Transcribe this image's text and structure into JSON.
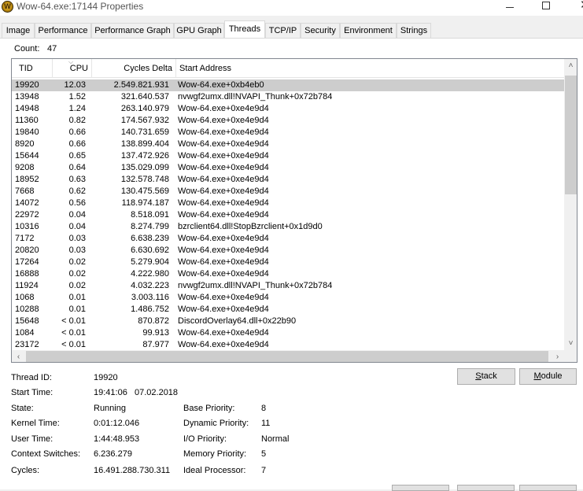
{
  "window": {
    "title": "Wow-64.exe:17144 Properties",
    "icon": "wow-logo-icon",
    "icon_letter": "W"
  },
  "tabs": [
    {
      "label": "Image"
    },
    {
      "label": "Performance"
    },
    {
      "label": "Performance Graph"
    },
    {
      "label": "GPU Graph"
    },
    {
      "label": "Threads",
      "active": true
    },
    {
      "label": "TCP/IP"
    },
    {
      "label": "Security"
    },
    {
      "label": "Environment"
    },
    {
      "label": "Strings"
    }
  ],
  "count": {
    "label": "Count:",
    "value": "47"
  },
  "threads": {
    "columns": [
      "TID",
      "CPU",
      "Cycles Delta",
      "Start Address"
    ],
    "rows": [
      {
        "tid": "19920",
        "cpu": "12.03",
        "cycles": "2.549.821.931",
        "address": "Wow-64.exe+0xb4eb0",
        "selected": true
      },
      {
        "tid": "13948",
        "cpu": "1.52",
        "cycles": "321.640.537",
        "address": "nvwgf2umx.dll!NVAPI_Thunk+0x72b784"
      },
      {
        "tid": "14948",
        "cpu": "1.24",
        "cycles": "263.140.979",
        "address": "Wow-64.exe+0xe4e9d4"
      },
      {
        "tid": "11360",
        "cpu": "0.82",
        "cycles": "174.567.932",
        "address": "Wow-64.exe+0xe4e9d4"
      },
      {
        "tid": "19840",
        "cpu": "0.66",
        "cycles": "140.731.659",
        "address": "Wow-64.exe+0xe4e9d4"
      },
      {
        "tid": "8920",
        "cpu": "0.66",
        "cycles": "138.899.404",
        "address": "Wow-64.exe+0xe4e9d4"
      },
      {
        "tid": "15644",
        "cpu": "0.65",
        "cycles": "137.472.926",
        "address": "Wow-64.exe+0xe4e9d4"
      },
      {
        "tid": "9208",
        "cpu": "0.64",
        "cycles": "135.029.099",
        "address": "Wow-64.exe+0xe4e9d4"
      },
      {
        "tid": "18952",
        "cpu": "0.63",
        "cycles": "132.578.748",
        "address": "Wow-64.exe+0xe4e9d4"
      },
      {
        "tid": "7668",
        "cpu": "0.62",
        "cycles": "130.475.569",
        "address": "Wow-64.exe+0xe4e9d4"
      },
      {
        "tid": "14072",
        "cpu": "0.56",
        "cycles": "118.974.187",
        "address": "Wow-64.exe+0xe4e9d4"
      },
      {
        "tid": "22972",
        "cpu": "0.04",
        "cycles": "8.518.091",
        "address": "Wow-64.exe+0xe4e9d4"
      },
      {
        "tid": "10316",
        "cpu": "0.04",
        "cycles": "8.274.799",
        "address": "bzrclient64.dll!StopBzrclient+0x1d9d0"
      },
      {
        "tid": "7172",
        "cpu": "0.03",
        "cycles": "6.638.239",
        "address": "Wow-64.exe+0xe4e9d4"
      },
      {
        "tid": "20820",
        "cpu": "0.03",
        "cycles": "6.630.692",
        "address": "Wow-64.exe+0xe4e9d4"
      },
      {
        "tid": "17264",
        "cpu": "0.02",
        "cycles": "5.279.904",
        "address": "Wow-64.exe+0xe4e9d4"
      },
      {
        "tid": "16888",
        "cpu": "0.02",
        "cycles": "4.222.980",
        "address": "Wow-64.exe+0xe4e9d4"
      },
      {
        "tid": "11924",
        "cpu": "0.02",
        "cycles": "4.032.223",
        "address": "nvwgf2umx.dll!NVAPI_Thunk+0x72b784"
      },
      {
        "tid": "1068",
        "cpu": "0.01",
        "cycles": "3.003.116",
        "address": "Wow-64.exe+0xe4e9d4"
      },
      {
        "tid": "10288",
        "cpu": "0.01",
        "cycles": "1.486.752",
        "address": "Wow-64.exe+0xe4e9d4"
      },
      {
        "tid": "15648",
        "cpu": "< 0.01",
        "cycles": "870.872",
        "address": "DiscordOverlay64.dll+0x22b90"
      },
      {
        "tid": "1084",
        "cpu": "< 0.01",
        "cycles": "99.913",
        "address": "Wow-64.exe+0xe4e9d4"
      },
      {
        "tid": "23172",
        "cpu": "< 0.01",
        "cycles": "87.977",
        "address": "Wow-64.exe+0xe4e9d4"
      }
    ]
  },
  "details": {
    "thread_id_label": "Thread ID:",
    "thread_id": "19920",
    "start_time_label": "Start Time:",
    "start_time": "19:41:06   07.02.2018",
    "state_label": "State:",
    "state": "Running",
    "base_priority_label": "Base Priority:",
    "base_priority": "8",
    "kernel_time_label": "Kernel Time:",
    "kernel_time": "0:01:12.046",
    "dynamic_priority_label": "Dynamic Priority:",
    "dynamic_priority": "11",
    "user_time_label": "User Time:",
    "user_time": "1:44:48.953",
    "io_priority_label": "I/O Priority:",
    "io_priority": "Normal",
    "context_switches_label": "Context Switches:",
    "context_switches": "6.236.279",
    "memory_priority_label": "Memory Priority:",
    "memory_priority": "5",
    "cycles_label": "Cycles:",
    "cycles": "16.491.288.730.311",
    "ideal_processor_label": "Ideal Processor:",
    "ideal_processor": "7"
  },
  "buttons": {
    "stack": {
      "accel": "S",
      "rest": "tack"
    },
    "module": {
      "accel": "M",
      "rest": "odule"
    }
  },
  "colors": {
    "selected_row": "#cdcdcd",
    "window_bg": "#f0f0f0",
    "border": "#828790"
  }
}
